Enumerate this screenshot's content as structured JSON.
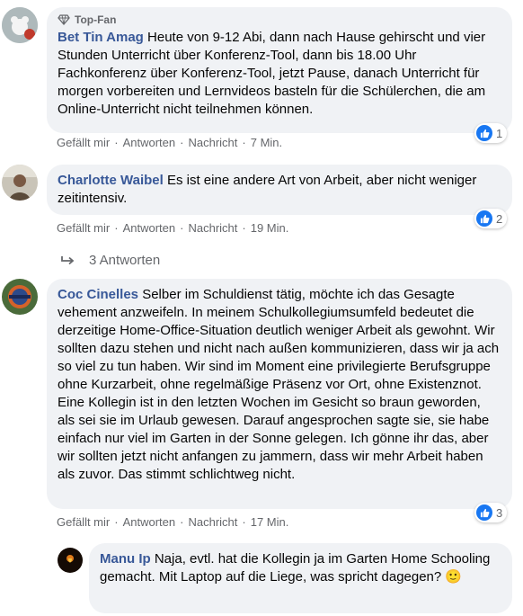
{
  "comments": [
    {
      "badge": "Top-Fan",
      "author": "Bet Tin Amag",
      "text": "Heute von 9-12 Abi, dann nach Hause gehirscht und vier Stunden Unterricht über Konferenz-Tool, dann bis 18.00 Uhr Fachkonferenz über Konferenz-Tool, jetzt Pause, danach Unterricht für morgen vorbereiten und Lernvideos basteln für die Schülerchen, die am Online-Unterricht nicht teilnehmen können.",
      "like_label": "Gefällt mir",
      "reply_label": "Antworten",
      "message_label": "Nachricht",
      "time": "7 Min.",
      "reaction_count": "1"
    },
    {
      "author": "Charlotte Waibel",
      "text": "Es ist eine andere Art von Arbeit, aber nicht weniger zeitintensiv.",
      "like_label": "Gefällt mir",
      "reply_label": "Antworten",
      "message_label": "Nachricht",
      "time": "19 Min.",
      "reaction_count": "2",
      "replies_link": "3 Antworten"
    },
    {
      "author": "Coc Cinelles",
      "text": "Selber im Schuldienst tätig, möchte ich das Gesagte vehement anzweifeln. In meinem Schulkollegiumsumfeld bedeutet die derzeitige Home-Office-Situation deutlich weniger Arbeit als gewohnt. Wir sollten dazu stehen und nicht nach außen kommunizieren, dass wir ja ach so viel zu tun haben. Wir sind im Moment eine privilegierte Berufsgruppe ohne Kurzarbeit, ohne regelmäßige Präsenz vor Ort, ohne Existenznot. Eine Kollegin ist in den letzten Wochen im Gesicht so braun geworden, als sei sie im Urlaub gewesen. Darauf angesprochen sagte sie, sie habe einfach nur viel im Garten in der Sonne gelegen. Ich gönne ihr das, aber wir sollten jetzt nicht anfangen zu jammern, dass wir mehr Arbeit haben als zuvor. Das stimmt schlichtweg nicht.",
      "like_label": "Gefällt mir",
      "reply_label": "Antworten",
      "message_label": "Nachricht",
      "time": "17 Min.",
      "reaction_count": "3"
    }
  ],
  "reply": {
    "author": "Manu Ip",
    "text": "Naja, evtl. hat die Kollegin ja im Garten Home Schooling gemacht. Mit Laptop auf die Liege, was spricht dagegen?",
    "emoji": "🙂"
  },
  "colors": {
    "author": "#385898",
    "meta": "#65676b",
    "bubble": "#f0f2f5",
    "like": "#1877f2"
  },
  "icons": [
    "diamond-icon",
    "like-thumb-icon",
    "reply-arrow-icon",
    "smiley-emoji"
  ]
}
